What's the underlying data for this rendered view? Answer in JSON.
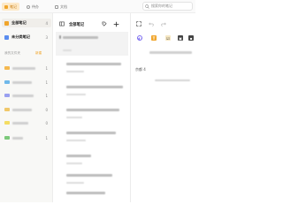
{
  "topbar": {
    "tabs": [
      {
        "label": "笔记",
        "active": true
      },
      {
        "label": "待办",
        "active": false
      },
      {
        "label": "文档",
        "active": false
      }
    ],
    "search_placeholder": "搜索你的笔记"
  },
  "sidebar": {
    "all_notes_label": "全部笔记",
    "all_notes_count": "4",
    "uncategorized_label": "未分类笔记",
    "uncategorized_count": "3",
    "folders_header": "我的文件夹",
    "folders_action": "新建",
    "folders": [
      {
        "color": "#f5b94f",
        "count": "1"
      },
      {
        "color": "#6fb8ea",
        "count": "1"
      },
      {
        "color": "#9aa0f0",
        "count": "1"
      },
      {
        "color": "#f0c86a",
        "count": "0"
      },
      {
        "color": "#f4dd63",
        "count": "0"
      },
      {
        "color": "#7cc97a",
        "count": "1"
      }
    ]
  },
  "list": {
    "title": "全部笔记"
  },
  "editor": {
    "snippet": "京都 4"
  },
  "colors": {
    "accent": "#f0a52b",
    "sidebar_bg": "#f8f8f6"
  },
  "icons": [
    "note-icon",
    "todo-icon",
    "doc-icon",
    "search-icon",
    "sidebar-toggle-icon",
    "tag-icon",
    "plus-icon",
    "expand-icon",
    "undo-icon",
    "redo-icon"
  ]
}
